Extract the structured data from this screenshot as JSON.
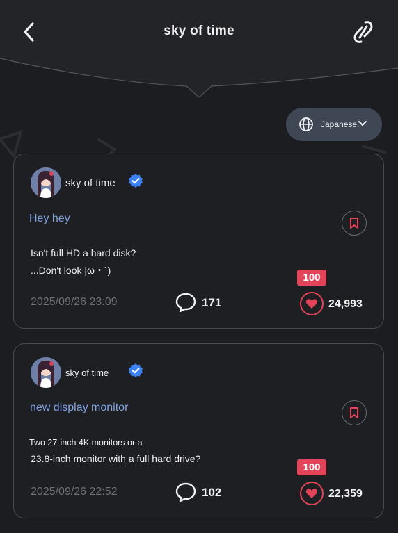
{
  "header": {
    "title": "sky of time"
  },
  "language": {
    "label": "Japanese"
  },
  "posts": [
    {
      "author": "sky of time",
      "title": "Hey hey",
      "body": [
        "Isn't full HD a hard disk?",
        "...Don't look |ω・`)"
      ],
      "date": "2025/09/26 23:09",
      "comments": "171",
      "badge": "100",
      "likes": "24,993"
    },
    {
      "author": "sky of time",
      "title": "new display monitor",
      "body": [
        "Two 27-inch 4K monitors or a",
        "23.8-inch monitor with a full hard drive?"
      ],
      "date": "2025/09/26 22:52",
      "comments": "102",
      "badge": "100",
      "likes": "22,359"
    }
  ],
  "colors": {
    "accent_red": "#e2455a",
    "link_blue": "#7fa2e0",
    "verified_blue": "#3b82f6"
  }
}
